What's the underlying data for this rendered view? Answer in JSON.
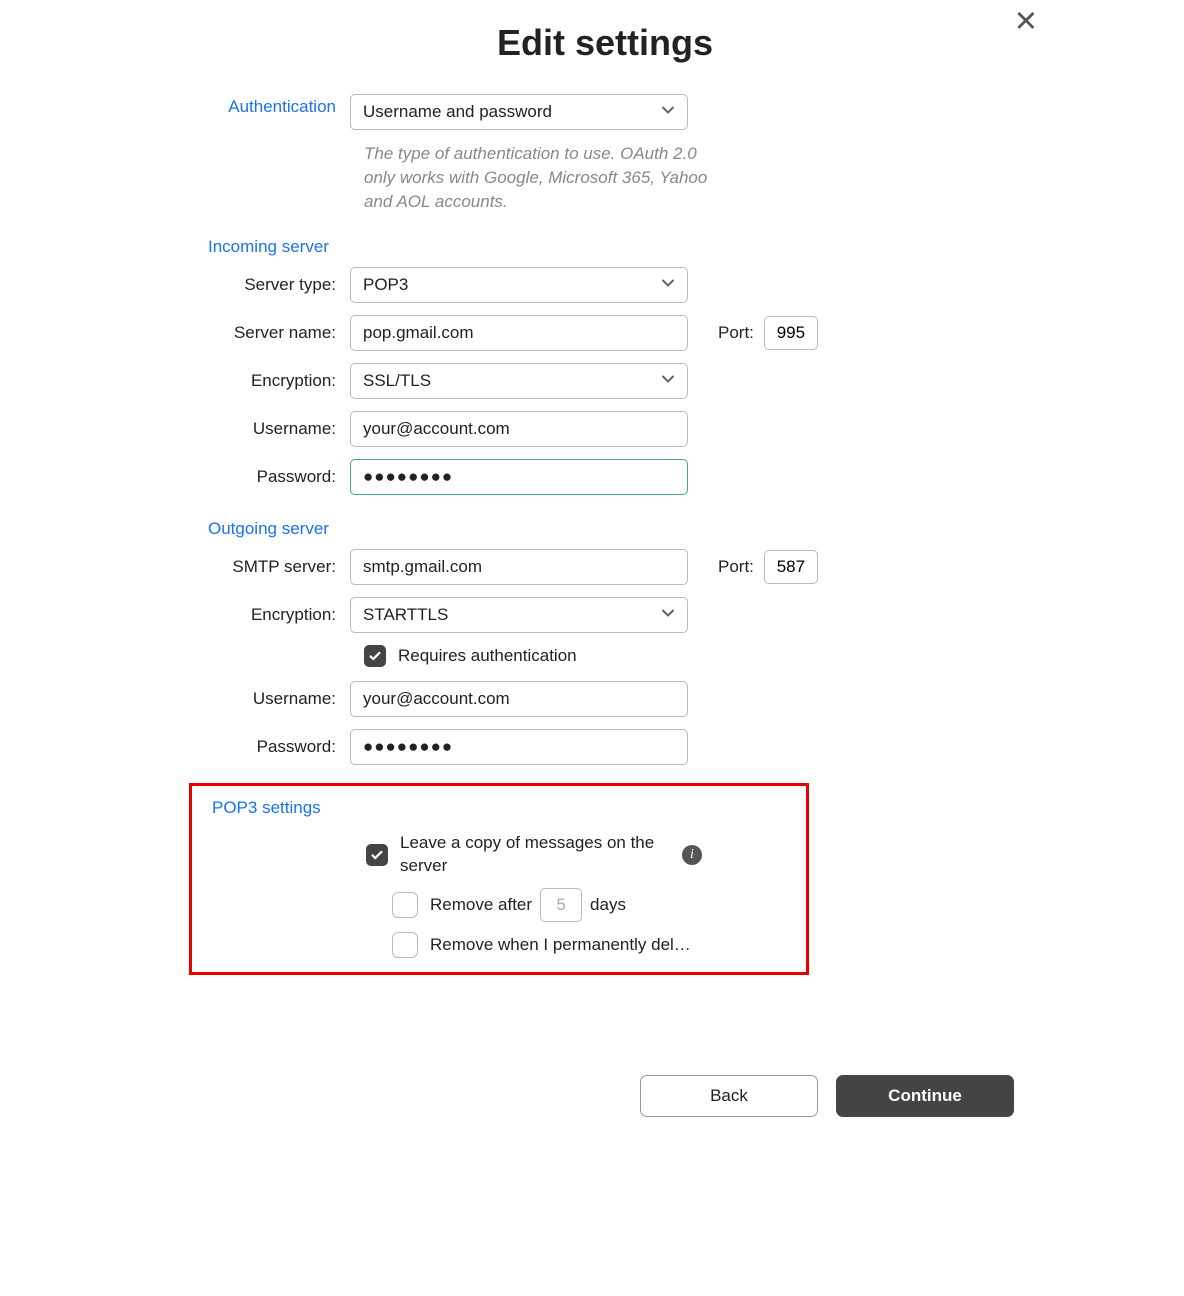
{
  "title": "Edit settings",
  "labels": {
    "authentication": "Authentication",
    "incoming_server": "Incoming server",
    "server_type": "Server type:",
    "server_name": "Server name:",
    "encryption": "Encryption:",
    "username": "Username:",
    "password": "Password:",
    "outgoing_server": "Outgoing server",
    "smtp_server": "SMTP server:",
    "port": "Port:",
    "pop3_settings": "POP3 settings",
    "leave_copy": "Leave a copy of messages on the server",
    "remove_after_prefix": "Remove after",
    "remove_after_suffix": "days",
    "remove_when_delete": "Remove when I permanently del…",
    "requires_auth": "Requires authentication"
  },
  "values": {
    "authentication": "Username and password",
    "auth_helper": "The type of authentication to use. OAuth 2.0 only works with Google, Microsoft 365, Yahoo and AOL accounts.",
    "in_server_type": "POP3",
    "in_server_name": "pop.gmail.com",
    "in_port": "995",
    "in_encryption": "SSL/TLS",
    "in_username": "your@account.com",
    "in_password": "●●●●●●●●",
    "out_server": "smtp.gmail.com",
    "out_port": "587",
    "out_encryption": "STARTTLS",
    "out_username": "your@account.com",
    "out_password": "●●●●●●●●",
    "remove_after_days": "5"
  },
  "buttons": {
    "back": "Back",
    "continue": "Continue"
  }
}
